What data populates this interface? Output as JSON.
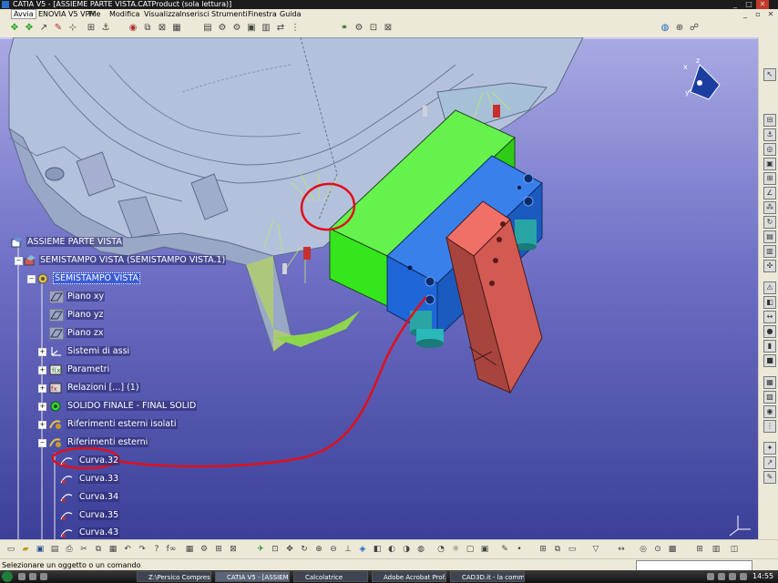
{
  "window": {
    "title": "CATIA V5 - [ASSIEME PARTE VISTA.CATProduct (sola lettura)]",
    "controls": [
      "_",
      "□",
      "✕"
    ]
  },
  "menu": {
    "items": [
      "Avvia",
      "ENOVIA V5 VPM",
      "File",
      "Modifica",
      "Visualizza",
      "Inserisci",
      "Strumenti",
      "Finestra",
      "Guida"
    ],
    "active": "Avvia"
  },
  "tree": {
    "root": "ASSIEME PARTE VISTA",
    "level1": "SEMISTAMPO VISTA (SEMISTAMPO VISTA.1)",
    "level2": "SEMISTAMPO VISTA",
    "items": [
      {
        "label": "Piano xy",
        "icon": "plane-icon"
      },
      {
        "label": "Piano yz",
        "icon": "plane-icon"
      },
      {
        "label": "Piano zx",
        "icon": "plane-icon"
      },
      {
        "label": "Sistemi di assi",
        "icon": "axis-system-icon"
      },
      {
        "label": "Parametri",
        "icon": "parameters-icon"
      },
      {
        "label": "Relazioni [...] (1)",
        "icon": "relations-icon"
      },
      {
        "label": "SOLIDO FINALE - FINAL SOLID",
        "icon": "body-icon"
      },
      {
        "label": "Riferimenti esterni isolati",
        "icon": "geometrical-set-icon"
      },
      {
        "label": "Riferimenti esterni",
        "icon": "geometrical-set-icon"
      }
    ],
    "curves": [
      "Curva.32",
      "Curva.33",
      "Curva.34",
      "Curva.35",
      "Curva.43"
    ]
  },
  "compass": {
    "x": "x",
    "y": "y",
    "z": "z"
  },
  "status": {
    "text": "Selezionare un oggetto o un comando"
  },
  "taskbar": {
    "tasks": [
      "Z:\\Persico Compresi...",
      "CATIA V5 - [ASSIEM...",
      "Calcolatrice",
      "Adobe Acrobat Prof...",
      "CAD3D.it - la comm..."
    ],
    "active_index": 1,
    "clock": "14:55"
  },
  "colors": {
    "green_block": "#35e61d",
    "blue_block": "#1f67d8",
    "salmon_plate": "#f07068",
    "annotation": "#e0101a",
    "cylinder": "#2aa5a5"
  }
}
